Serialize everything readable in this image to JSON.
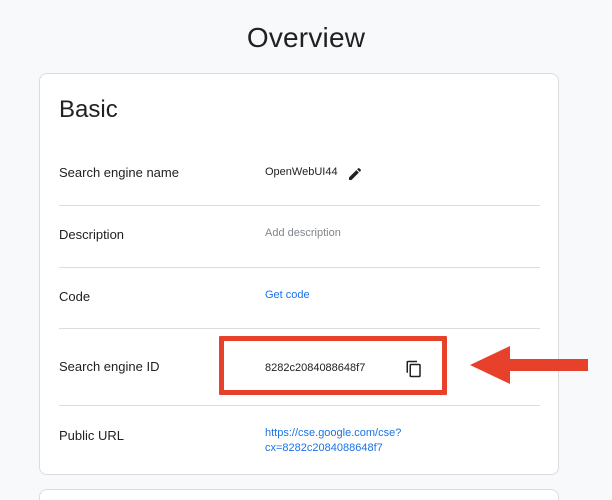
{
  "page": {
    "title": "Overview"
  },
  "basic": {
    "title": "Basic",
    "rows": [
      {
        "label": "Search engine name",
        "value": "OpenWebUI44"
      },
      {
        "label": "Description",
        "value": "Add description"
      },
      {
        "label": "Code",
        "value": "Get code"
      },
      {
        "label": "Search engine ID",
        "value": "8282c2084088648f7"
      },
      {
        "label": "Public URL",
        "value_line1": "https://cse.google.com/cse?",
        "value_line2": "cx=8282c2084088648f7"
      }
    ]
  },
  "icons": {
    "edit": "pencil-icon",
    "copy": "copy-icon",
    "annotation": "arrow-left-icon"
  },
  "colors": {
    "link": "#1a73e8",
    "annotation": "#e8412b",
    "divider": "#dadce0"
  }
}
